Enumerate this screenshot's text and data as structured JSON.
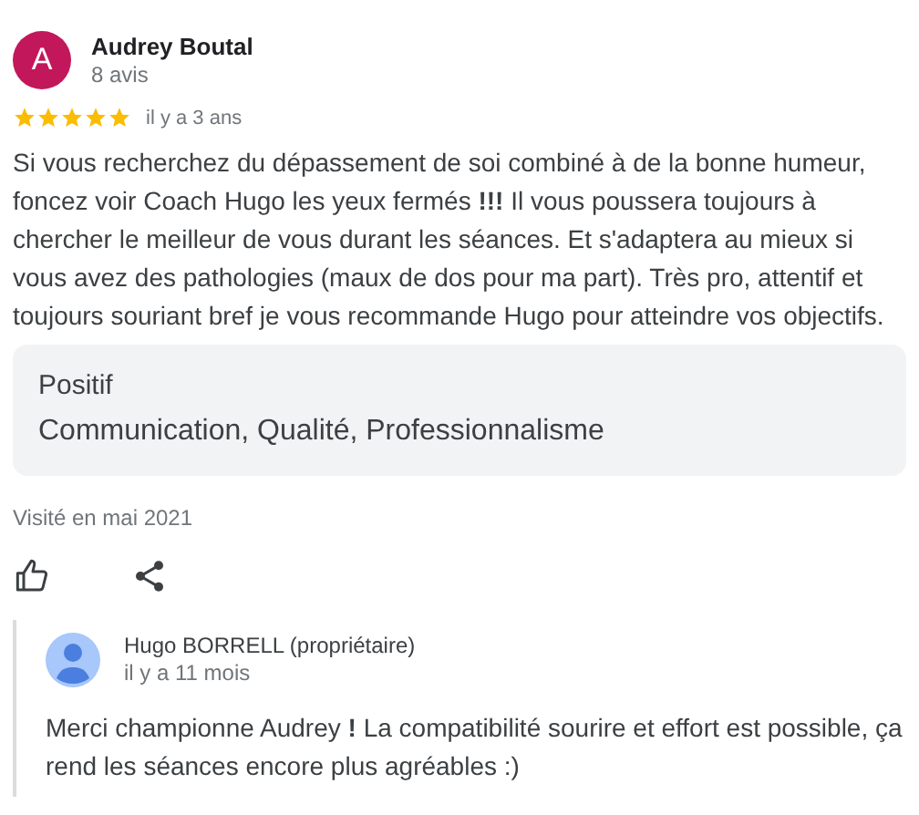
{
  "review": {
    "avatar_letter": "A",
    "author": "Audrey Boutal",
    "review_count": "8 avis",
    "stars": 5,
    "time": "il y a 3 ans",
    "text": "Si vous recherchez du dépassement de soi combiné à de la bonne humeur, foncez voir Coach Hugo les yeux fermés **!!!** Il vous poussera toujours à chercher le meilleur de vous durant les séances. Et s'adaptera au mieux si vous avez des pathologies (maux de dos pour ma part). Très pro, attentif et toujours souriant bref je vous recommande Hugo pour atteindre vos objectifs.",
    "highlights": {
      "title": "Positif",
      "items": "Communication, Qualité, Professionnalisme"
    },
    "visited": "Visité en mai 2021"
  },
  "reply": {
    "author": "Hugo BORRELL (propriétaire)",
    "time": "il y a 11 mois",
    "text": "Merci championne Audrey **!** La compatibilité sourire et effort est possible, ça rend les séances encore plus agréables :)"
  }
}
